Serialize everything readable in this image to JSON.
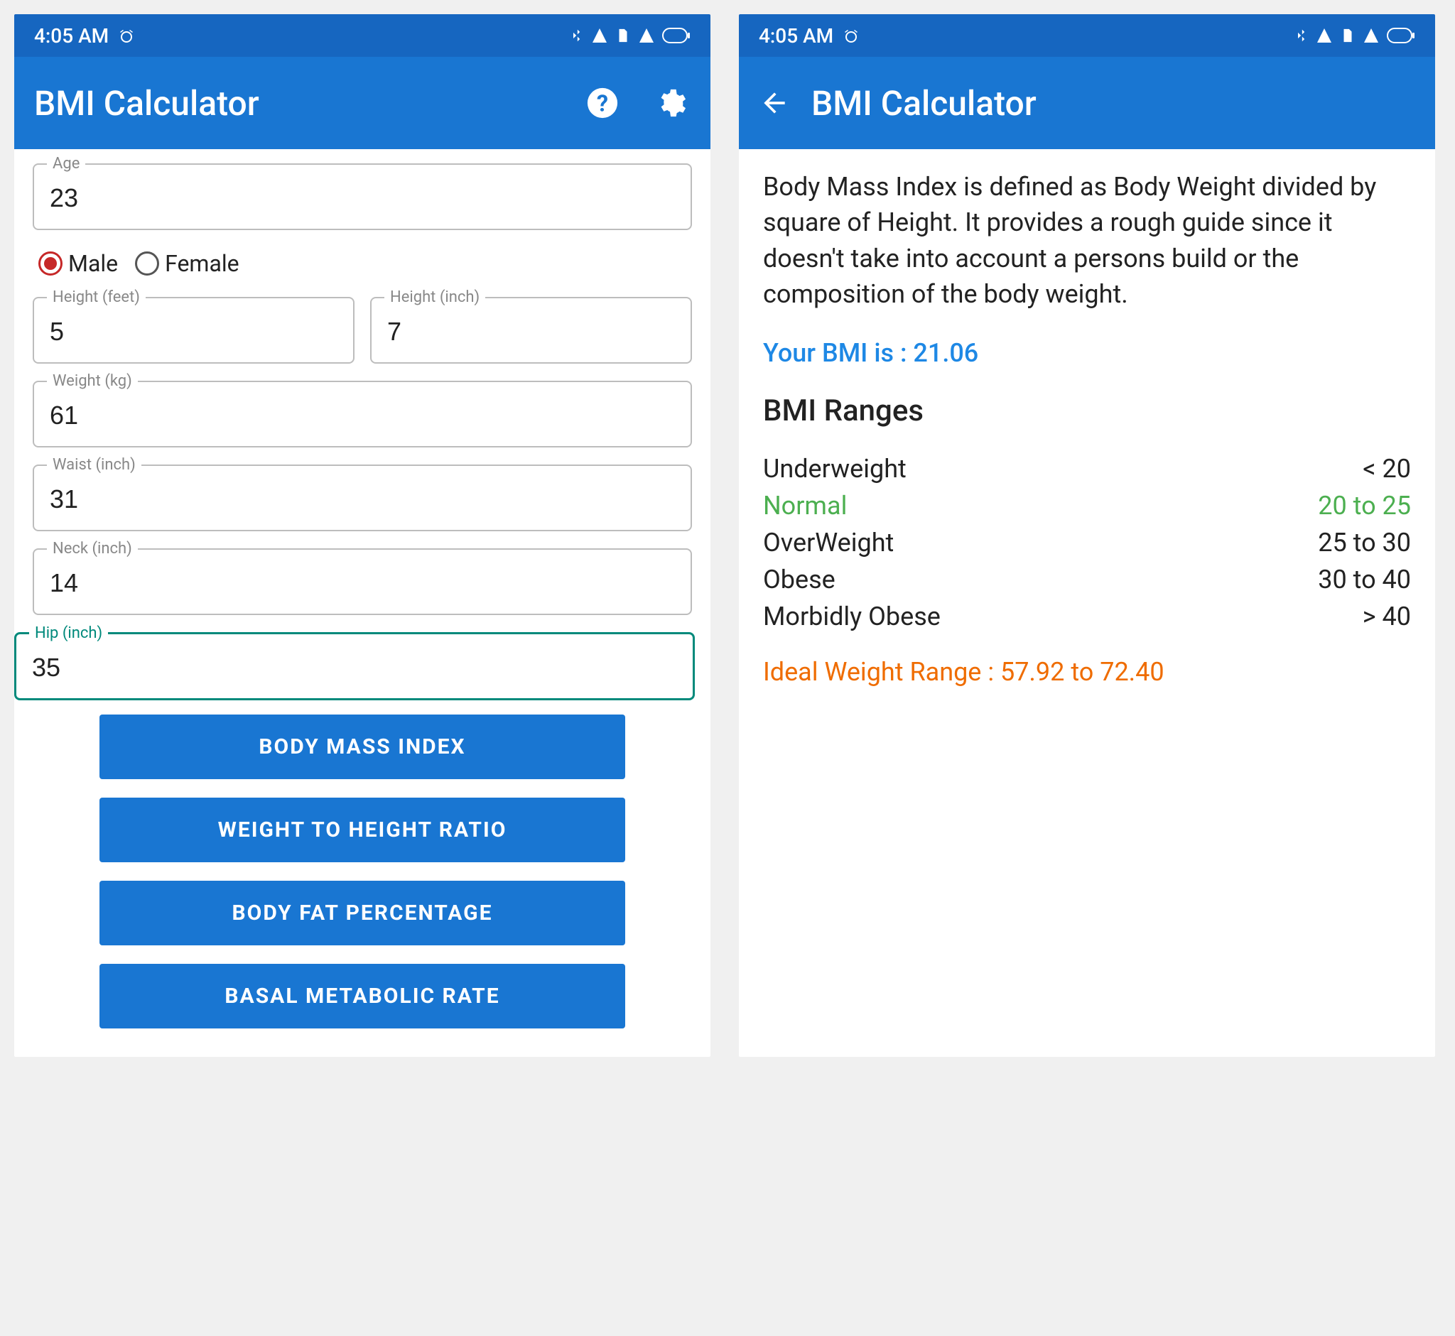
{
  "statusbar": {
    "time": "4:05 AM"
  },
  "appbar": {
    "title": "BMI Calculator"
  },
  "form": {
    "age_label": "Age",
    "age_value": "23",
    "gender_male": "Male",
    "gender_female": "Female",
    "gender_selected": "male",
    "height_feet_label": "Height (feet)",
    "height_feet_value": "5",
    "height_inch_label": "Height (inch)",
    "height_inch_value": "7",
    "weight_label": "Weight (kg)",
    "weight_value": "61",
    "waist_label": "Waist (inch)",
    "waist_value": "31",
    "neck_label": "Neck (inch)",
    "neck_value": "14",
    "hip_label": "Hip (inch)",
    "hip_value": "35"
  },
  "buttons": {
    "bmi": "BODY MASS INDEX",
    "wthr": "WEIGHT TO HEIGHT RATIO",
    "bfp": "BODY FAT PERCENTAGE",
    "bmr": "BASAL METABOLIC RATE"
  },
  "results": {
    "definition": "Body Mass Index is defined as Body Weight divided by square of Height. It provides a rough guide since it doesn't take into account a persons build or the composition of the body weight.",
    "your_bmi_label": "Your BMI is : ",
    "your_bmi_value": "21.06",
    "ranges_heading": "BMI Ranges",
    "ranges": [
      {
        "name": "Underweight",
        "value": "< 20",
        "class": ""
      },
      {
        "name": "Normal",
        "value": "20 to 25",
        "class": "normal"
      },
      {
        "name": "OverWeight",
        "value": "25 to 30",
        "class": ""
      },
      {
        "name": "Obese",
        "value": "30 to 40",
        "class": ""
      },
      {
        "name": "Morbidly Obese",
        "value": "> 40",
        "class": ""
      }
    ],
    "ideal_label": "Ideal Weight Range : ",
    "ideal_value": "57.92 to 72.40"
  }
}
